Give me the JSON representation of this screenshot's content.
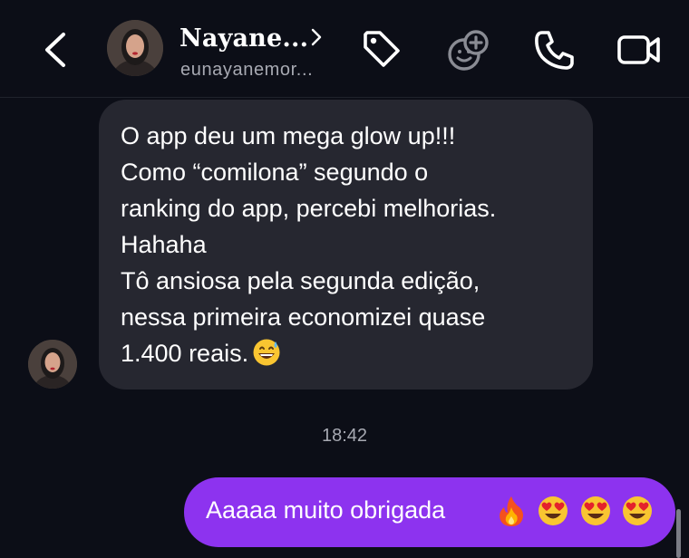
{
  "header": {
    "contact_name": "Nayane...",
    "contact_username": "eunayanemor...",
    "icons": {
      "back": "back-chevron-icon",
      "name_more": "chevron-right-icon",
      "tag": "tag-icon",
      "sticker": "sticker-add-icon",
      "call": "phone-icon",
      "video": "video-camera-icon"
    }
  },
  "conversation": {
    "incoming": {
      "lines": [
        "O app deu um mega glow up!!!",
        "Como “comilona” segundo o",
        "ranking do app, percebi melhorias.",
        "Hahaha",
        "Tô ansiosa pela segunda edição,",
        "nessa primeira economizei quase",
        "1.400 reais."
      ],
      "emoji": "😅"
    },
    "timestamp": "18:42",
    "outgoing": {
      "text": "Aaaaa muito obrigada",
      "emojis": [
        "🔥",
        "😍",
        "😍",
        "😍"
      ]
    }
  },
  "colors": {
    "background": "#0c0e17",
    "incoming_bubble": "#262730",
    "outgoing_bubble": "#8d33ef",
    "secondary_text": "#a7a9b2"
  }
}
